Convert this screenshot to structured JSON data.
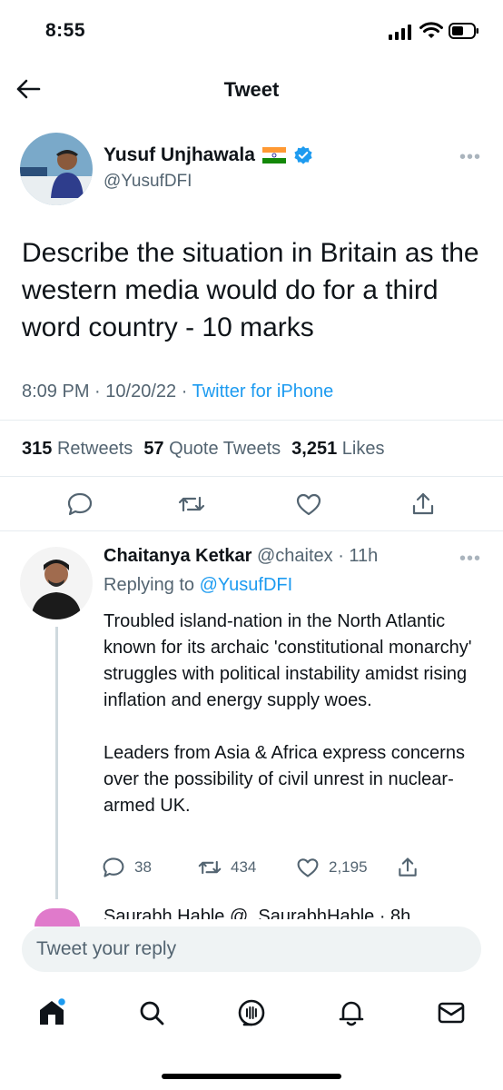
{
  "status_bar": {
    "time": "8:55"
  },
  "header": {
    "title": "Tweet"
  },
  "tweet": {
    "author_name": "Yusuf Unjhawala",
    "author_handle": "@YusufDFI",
    "text": "Describe the situation in Britain as the western media would do for a third word country - 10 marks",
    "time": "8:09 PM",
    "date": "10/20/22",
    "separator": "·",
    "source": "Twitter for iPhone",
    "retweets_count": "315",
    "retweets_label": "Retweets",
    "quotes_count": "57",
    "quotes_label": "Quote Tweets",
    "likes_count": "3,251",
    "likes_label": "Likes"
  },
  "reply": {
    "author_name": "Chaitanya Ketkar",
    "author_handle": "@chaitex",
    "age": "· 11h",
    "replying_prefix": "Replying to",
    "replying_to": "@YusufDFI",
    "paragraph1": "Troubled island-nation in the North Atlantic known for its archaic 'constitutional monarchy' struggles with political instability amidst rising inflation and energy supply woes.",
    "paragraph2": "Leaders from Asia & Africa express concerns over the possibility of civil unrest in nuclear-armed UK.",
    "replies": "38",
    "retweets": "434",
    "likes": "2,195"
  },
  "next_reply_partial": "Saurabh Hable @_SaurabhHable · 8h",
  "compose": {
    "placeholder": "Tweet your reply"
  },
  "more_label": "•••",
  "colors": {
    "accent": "#1d9bf0",
    "secondary_text": "#536471",
    "divider": "#e6ecf0"
  },
  "icons": [
    "back-arrow-icon",
    "verified-badge-icon",
    "india-flag-icon",
    "reply-icon",
    "retweet-icon",
    "like-icon",
    "share-icon",
    "home-icon",
    "search-icon",
    "spaces-icon",
    "notifications-icon",
    "messages-icon"
  ]
}
